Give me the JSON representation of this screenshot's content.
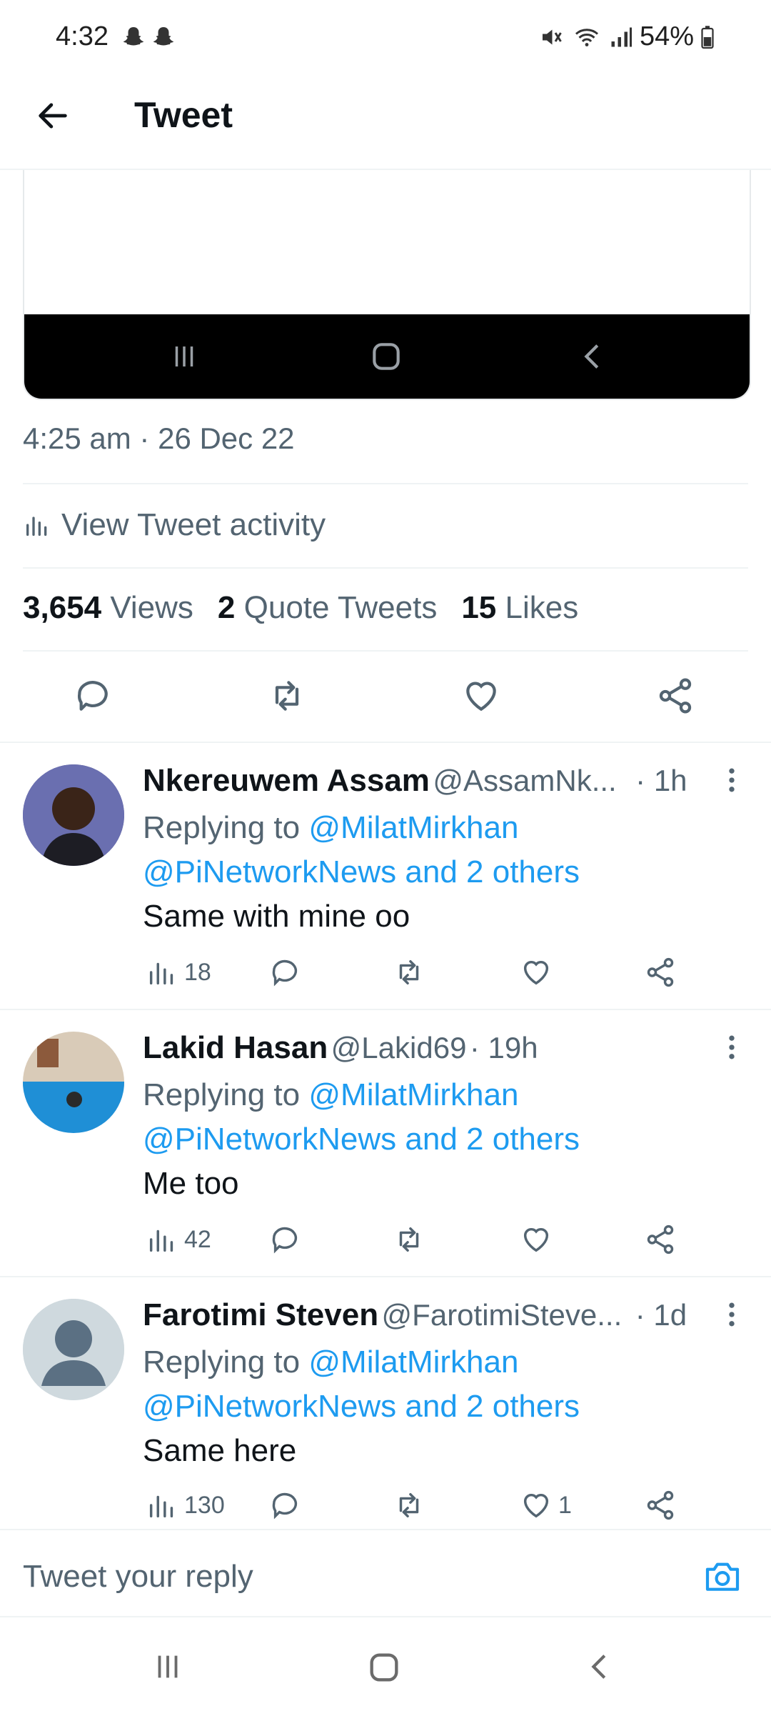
{
  "status_bar": {
    "time": "4:32",
    "battery": "54%"
  },
  "header": {
    "title": "Tweet"
  },
  "tweet": {
    "timestamp": "4:25 am · 26 Dec 22",
    "view_activity": "View Tweet activity",
    "stats": [
      {
        "count": "3,654",
        "label": "Views"
      },
      {
        "count": "2",
        "label": "Quote Tweets"
      },
      {
        "count": "15",
        "label": "Likes"
      }
    ]
  },
  "replies": [
    {
      "name": "Nkereuwem Assam",
      "handle": "@AssamNk...",
      "time": "· 1h",
      "replying_prefix": "Replying to",
      "replying_to": "@MilatMirkhan",
      "replying_more": "@PiNetworkNews and 2 others",
      "text": "Same with mine oo",
      "views": "18",
      "likes": ""
    },
    {
      "name": "Lakid Hasan",
      "handle": "@Lakid69",
      "time": "· 19h",
      "replying_prefix": "Replying to",
      "replying_to": "@MilatMirkhan",
      "replying_more": "@PiNetworkNews and 2 others",
      "text": "Me too",
      "views": "42",
      "likes": ""
    },
    {
      "name": "Farotimi Steven",
      "handle": "@FarotimiSteve...",
      "time": "· 1d",
      "replying_prefix": "Replying to",
      "replying_to": "@MilatMirkhan",
      "replying_more": "@PiNetworkNews and 2 others",
      "text": "Same here",
      "views": "130",
      "likes": "1"
    }
  ],
  "composer": {
    "placeholder": "Tweet your reply"
  },
  "colors": {
    "accent": "#1d9bf0",
    "secondary_text": "#536471",
    "primary_text": "#0f1419"
  },
  "icons": [
    "back-arrow-icon",
    "analytics-icon",
    "reply-icon",
    "retweet-icon",
    "like-icon",
    "share-icon",
    "more-icon",
    "camera-icon"
  ]
}
